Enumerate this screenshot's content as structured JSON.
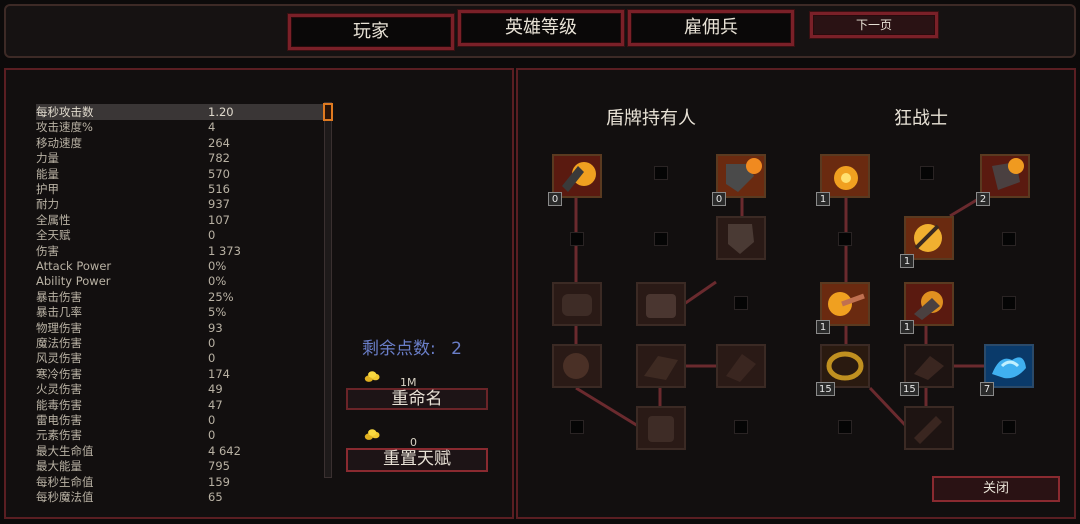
{
  "nav": {
    "player": "玩家",
    "hero_level": "英雄等级",
    "mercenary": "雇佣兵",
    "next_page": "下一页"
  },
  "stats": [
    {
      "name": "每秒攻击数",
      "value": "1.20"
    },
    {
      "name": "攻击速度%",
      "value": "4"
    },
    {
      "name": "移动速度",
      "value": "264"
    },
    {
      "name": "力量",
      "value": "782"
    },
    {
      "name": "能量",
      "value": "570"
    },
    {
      "name": "护甲",
      "value": "516"
    },
    {
      "name": "耐力",
      "value": "937"
    },
    {
      "name": "全属性",
      "value": "107"
    },
    {
      "name": "全天赋",
      "value": "0"
    },
    {
      "name": "伤害",
      "value": "1 373"
    },
    {
      "name": "Attack Power",
      "value": "0%"
    },
    {
      "name": "Ability Power",
      "value": "0%"
    },
    {
      "name": "暴击伤害",
      "value": "25%"
    },
    {
      "name": "暴击几率",
      "value": "5%"
    },
    {
      "name": "物理伤害",
      "value": "93"
    },
    {
      "name": "魔法伤害",
      "value": "0"
    },
    {
      "name": "风灵伤害",
      "value": "0"
    },
    {
      "name": "寒冷伤害",
      "value": "174"
    },
    {
      "name": "火灵伤害",
      "value": "49"
    },
    {
      "name": "能毒伤害",
      "value": "47"
    },
    {
      "name": "雷电伤害",
      "value": "0"
    },
    {
      "name": "元素伤害",
      "value": "0"
    },
    {
      "name": "最大生命值",
      "value": "4 642"
    },
    {
      "name": "最大能量",
      "value": "795"
    },
    {
      "name": "每秒生命值",
      "value": "159"
    },
    {
      "name": "每秒魔法值",
      "value": "65"
    }
  ],
  "points": {
    "label": "剩余点数:",
    "value": "2"
  },
  "rename": {
    "cost": "1M",
    "label": "重命名"
  },
  "reset": {
    "cost": "0",
    "label": "重置天赋"
  },
  "trees": {
    "left_title": "盾牌持有人",
    "right_title": "狂战士"
  },
  "skills": {
    "s1": "0",
    "s2": "0",
    "s3": "1",
    "s4": "2",
    "s5": "1",
    "s6": "1",
    "s7": "1",
    "s8": "15",
    "s9": "15",
    "s10": "7"
  },
  "close": "关闭",
  "colors": {
    "accent": "#7a2028",
    "frame": "#5a1e22"
  }
}
